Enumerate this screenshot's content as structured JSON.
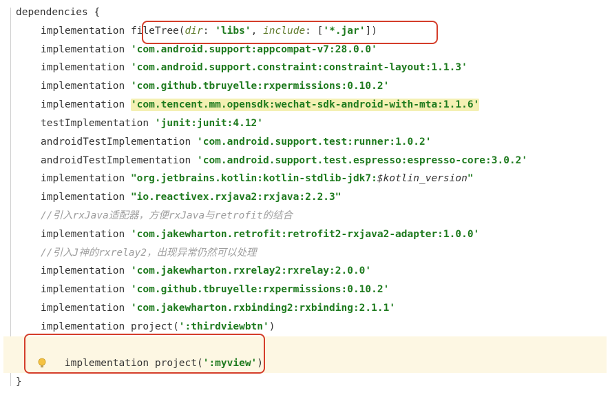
{
  "header": "dependencies {",
  "lines": {
    "l1_kw": "implementation",
    "l1_method": "fileTree",
    "l1_arg1name": "dir",
    "l1_arg1val": "'libs'",
    "l1_arg2name": "include",
    "l1_arg2val": "'*.jar'",
    "l2_kw": "implementation",
    "l2_str": "'com.android.support:appcompat-v7:28.0.0'",
    "l3_kw": "implementation",
    "l3_str": "'com.android.support.constraint:constraint-layout:1.1.3'",
    "l4_kw": "implementation",
    "l4_str": "'com.github.tbruyelle:rxpermissions:0.10.2'",
    "l5_kw": "implementation",
    "l5_str": "'com.tencent.mm.opensdk:wechat-sdk-android-with-mta:1.1.6'",
    "l6_kw": "testImplementation",
    "l6_str": "'junit:junit:4.12'",
    "l7_kw": "androidTestImplementation",
    "l7_str": "'com.android.support.test:runner:1.0.2'",
    "l8_kw": "androidTestImplementation",
    "l8_str": "'com.android.support.test.espresso:espresso-core:3.0.2'",
    "l9_kw": "implementation",
    "l9_str_a": "\"org.jetbrains.kotlin:kotlin-stdlib-jdk7:",
    "l9_interp": "$kotlin_version",
    "l9_str_b": "\"",
    "l10_kw": "implementation",
    "l10_str": "\"io.reactivex.rxjava2:rxjava:2.2.3\"",
    "c1": "//引入rxJava适配器，方便rxJava与retrofit的结合",
    "l11_kw": "implementation",
    "l11_str": "'com.jakewharton.retrofit:retrofit2-rxjava2-adapter:1.0.0'",
    "c2": "//引入J神的rxrelay2，出现异常仍然可以处理",
    "l12_kw": "implementation",
    "l12_str": "'com.jakewharton.rxrelay2:rxrelay:2.0.0'",
    "l13_kw": "implementation",
    "l13_str": "'com.github.tbruyelle:rxpermissions:0.10.2'",
    "l14_kw": "implementation",
    "l14_str": "'com.jakewharton.rxbinding2:rxbinding:2.1.1'",
    "l15_kw": "implementation",
    "l15_method": "project",
    "l15_str": "':thirdviewbtn'",
    "l16_kw": "implementation",
    "l16_method": "project",
    "l16_str": "':myview'"
  },
  "footer": "}"
}
